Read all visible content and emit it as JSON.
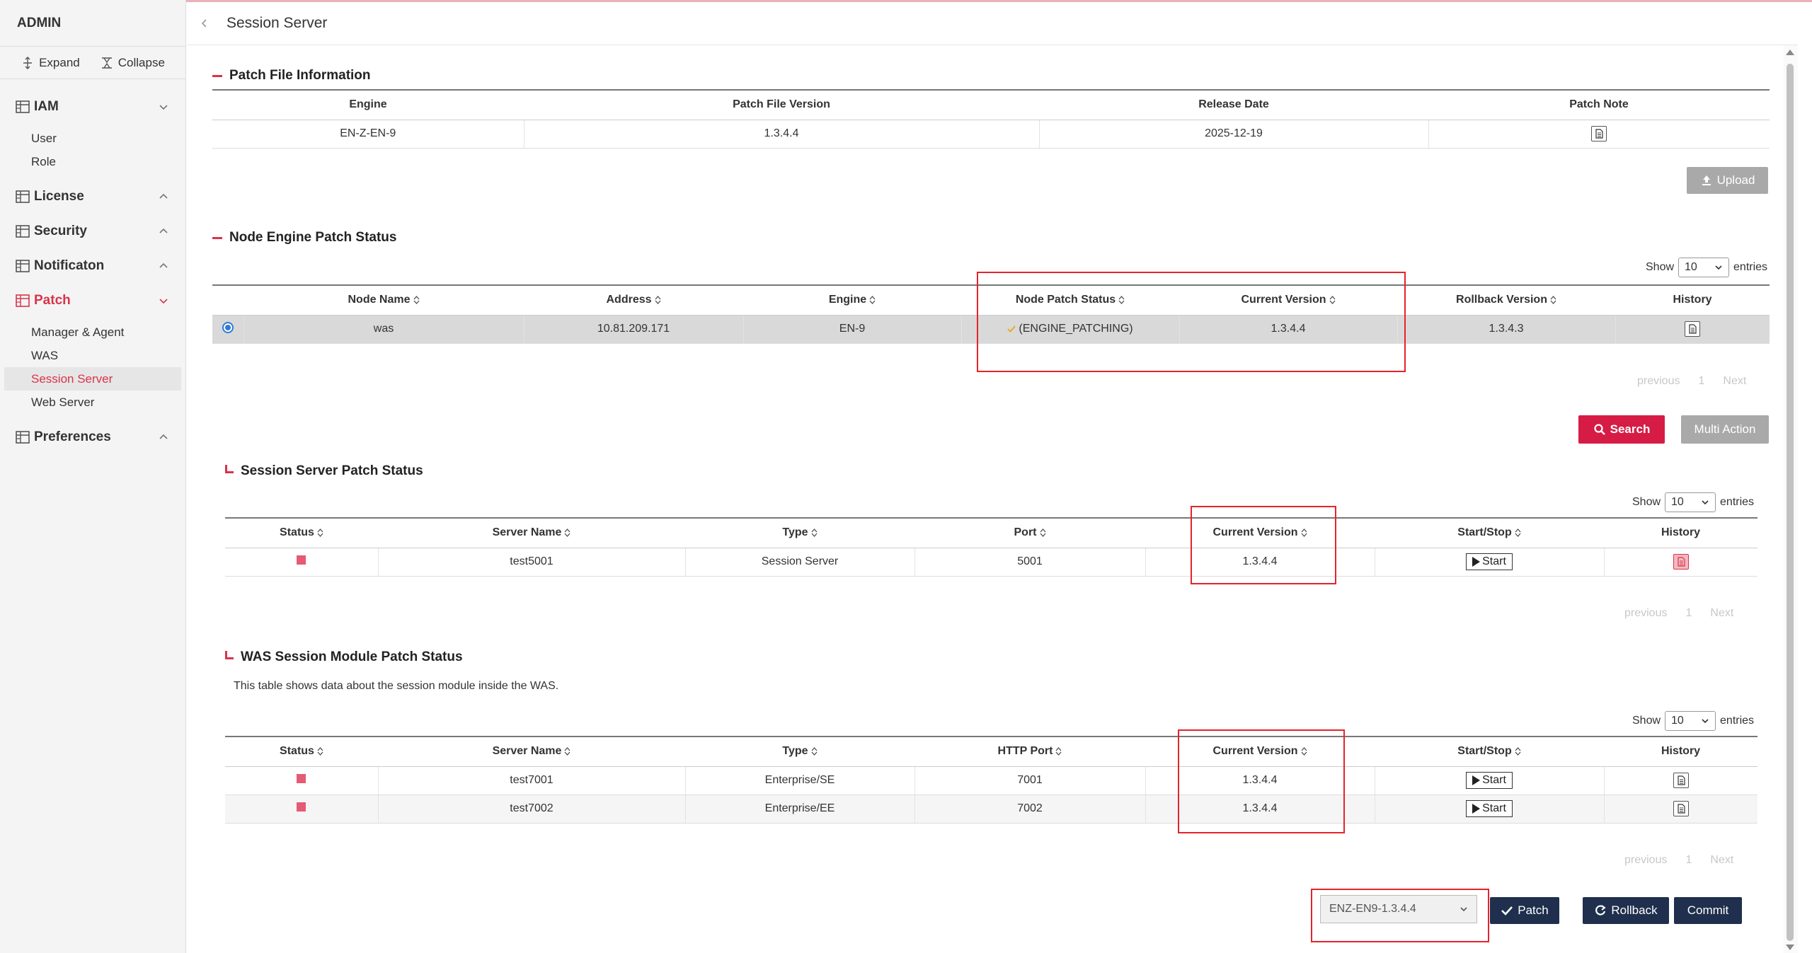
{
  "sidebar": {
    "title": "ADMIN",
    "expand_label": "Expand",
    "collapse_label": "Collapse",
    "groups": [
      {
        "label": "IAM",
        "subs": [
          "User",
          "Role"
        ]
      },
      {
        "label": "License"
      },
      {
        "label": "Security"
      },
      {
        "label": "Notificaton"
      },
      {
        "label": "Patch",
        "subs": [
          "Manager & Agent",
          "WAS",
          "Session Server",
          "Web Server"
        ]
      },
      {
        "label": "Preferences"
      }
    ],
    "active_group": "Patch",
    "active_sub": "Session Server"
  },
  "header": {
    "title": "Session Server"
  },
  "patch_file": {
    "title": "Patch File Information",
    "headers": [
      "Engine",
      "Patch File Version",
      "Release Date",
      "Patch Note"
    ],
    "row": {
      "engine": "EN-Z-EN-9",
      "version": "1.3.4.4",
      "release_date": "2025-12-19"
    },
    "upload_label": "Upload"
  },
  "node_engine": {
    "title": "Node Engine Patch Status",
    "show_label": "Show",
    "entries_value": "10",
    "entries_label": "entries",
    "headers": [
      "Node Name",
      "Address",
      "Engine",
      "Node Patch Status",
      "Current Version",
      "Rollback Version",
      "History"
    ],
    "rows": [
      {
        "node_name": "was",
        "address": "10.81.209.171",
        "engine": "EN-9",
        "status": "(ENGINE_PATCHING)",
        "current": "1.3.4.4",
        "rollback": "1.3.4.3"
      }
    ],
    "pager": {
      "previous": "previous",
      "page": "1",
      "next": "Next"
    },
    "search_label": "Search",
    "multi_action_label": "Multi Action"
  },
  "session_server": {
    "title": "Session Server Patch Status",
    "show_label": "Show",
    "entries_value": "10",
    "entries_label": "entries",
    "headers": [
      "Status",
      "Server Name",
      "Type",
      "Port",
      "Current Version",
      "Start/Stop",
      "History"
    ],
    "rows": [
      {
        "server_name": "test5001",
        "type": "Session Server",
        "port": "5001",
        "current": "1.3.4.4",
        "action": "Start"
      }
    ],
    "pager": {
      "previous": "previous",
      "page": "1",
      "next": "Next"
    }
  },
  "was_module": {
    "title": "WAS Session Module Patch Status",
    "note": "This table shows data about the session module inside the WAS.",
    "show_label": "Show",
    "entries_value": "10",
    "entries_label": "entries",
    "headers": [
      "Status",
      "Server Name",
      "Type",
      "HTTP Port",
      "Current Version",
      "Start/Stop",
      "History"
    ],
    "rows": [
      {
        "server_name": "test7001",
        "type": "Enterprise/SE",
        "port": "7001",
        "current": "1.3.4.4",
        "action": "Start"
      },
      {
        "server_name": "test7002",
        "type": "Enterprise/EE",
        "port": "7002",
        "current": "1.3.4.4",
        "action": "Start"
      }
    ],
    "pager": {
      "previous": "previous",
      "page": "1",
      "next": "Next"
    }
  },
  "footer": {
    "patch_select_value": "ENZ-EN9-1.3.4.4",
    "patch_label": "Patch",
    "rollback_label": "Rollback",
    "commit_label": "Commit"
  },
  "colors": {
    "accent": "#d8344b",
    "dark_button": "#1f2f4d",
    "status_stopped": "#e55a74",
    "highlight_box": "#e3242b"
  }
}
